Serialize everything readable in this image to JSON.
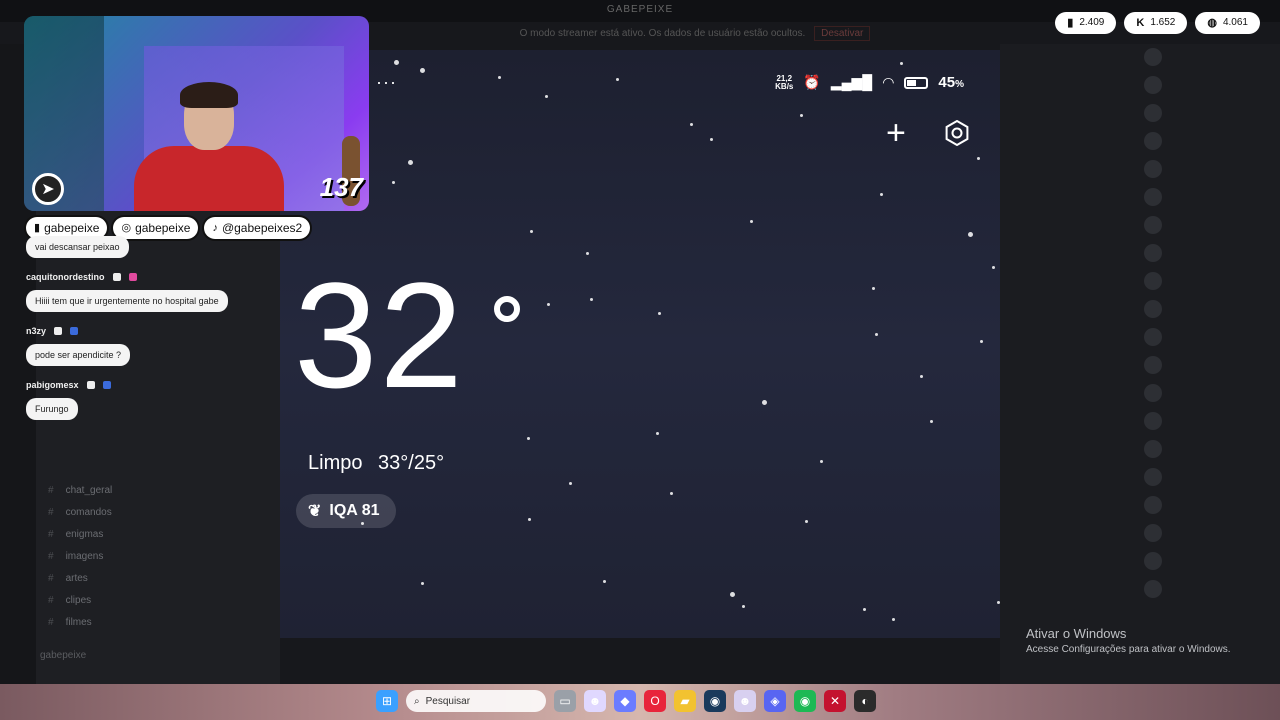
{
  "window": {
    "title": "GABEPEIXE"
  },
  "notice": {
    "text": "O modo streamer está ativo. Os dados de usuário estão ocultos.",
    "button": "Desativar"
  },
  "stats": [
    {
      "icon": "twitch-icon",
      "glyph": "▮",
      "value": "2.409"
    },
    {
      "icon": "kick-icon",
      "glyph": "K",
      "value": "1.652"
    },
    {
      "icon": "globe-icon",
      "glyph": "◍",
      "value": "4.061"
    }
  ],
  "webcam": {
    "viewer_count": "137"
  },
  "socials": [
    {
      "icon": "twitch-icon",
      "glyph": "▮",
      "handle": "gabepeixe"
    },
    {
      "icon": "instagram-icon",
      "glyph": "◎",
      "handle": "gabepeixe"
    },
    {
      "icon": "tiktok-icon",
      "glyph": "♪",
      "handle": "@gabepeixes2"
    }
  ],
  "chat": [
    {
      "user": "",
      "message": "vai descansar peixao",
      "badges": []
    },
    {
      "user": "caquitonordestino",
      "message": "Hiiii tem que ir urgentemente no hospital gabe",
      "badges": [
        "white",
        "pink"
      ]
    },
    {
      "user": "n3zy",
      "message": "pode ser apendicite ?",
      "badges": [
        "white",
        "blue"
      ]
    },
    {
      "user": "pabigomesx",
      "message": "Furungo",
      "badges": [
        "white",
        "blue"
      ]
    }
  ],
  "channels": [
    "chat_geral",
    "comandos",
    "enigmas",
    "imagens",
    "artes",
    "clipes",
    "filmes"
  ],
  "user_bar": {
    "name": "gabepeixe"
  },
  "phone": {
    "menu_dots": "···",
    "status": {
      "speed_value": "21,2",
      "speed_unit": "KB/s",
      "battery_pct": "45"
    },
    "weather": {
      "temperature": "32",
      "condition": "Limpo",
      "high_low": "33°/25°",
      "aqi": "IQA 81"
    }
  },
  "activation": {
    "title": "Ativar o Windows",
    "subtitle": "Acesse Configurações para ativar o Windows."
  },
  "taskbar": {
    "search_placeholder": "Pesquisar",
    "apps": [
      {
        "name": "windows-start-icon",
        "glyph": "⊞",
        "color": "#3aa0ff"
      },
      {
        "name": "file-icon",
        "glyph": "▭",
        "color": "#9aa0a8"
      },
      {
        "name": "face-app-icon",
        "glyph": "☻",
        "color": "#e0d8ff"
      },
      {
        "name": "copilot-icon",
        "glyph": "◆",
        "color": "#6b7cff"
      },
      {
        "name": "opera-icon",
        "glyph": "O",
        "color": "#e8243b"
      },
      {
        "name": "folder-icon",
        "glyph": "▰",
        "color": "#f2c230"
      },
      {
        "name": "steam-icon",
        "glyph": "◉",
        "color": "#1a3a5c"
      },
      {
        "name": "face-app-2-icon",
        "glyph": "☻",
        "color": "#d8d0f0"
      },
      {
        "name": "discord-icon",
        "glyph": "◈",
        "color": "#5865f2"
      },
      {
        "name": "spotify-icon",
        "glyph": "◉",
        "color": "#1db954"
      },
      {
        "name": "xsplit-icon",
        "glyph": "✕",
        "color": "#c4122f"
      },
      {
        "name": "obs-icon",
        "glyph": "◐",
        "color": "#2b2b2b"
      }
    ]
  }
}
